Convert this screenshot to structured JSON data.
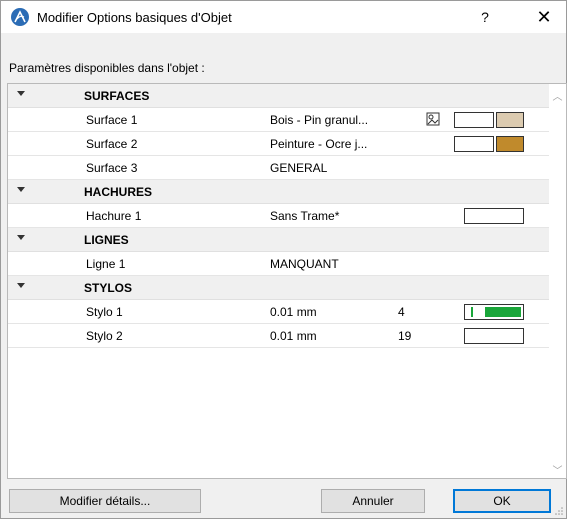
{
  "window": {
    "title": "Modifier Options basiques d'Objet",
    "help_label": "?",
    "close_label": "✕"
  },
  "panel": {
    "label": "Paramètres disponibles dans l'objet :"
  },
  "groups": [
    {
      "name": "SURFACES",
      "rows": [
        {
          "name": "Surface 1",
          "value": "Bois - Pin granul...",
          "swatch_color": "#dccbb0",
          "has_picker_icon": true
        },
        {
          "name": "Surface 2",
          "value": "Peinture - Ocre j...",
          "swatch_color": "#c08a2c"
        },
        {
          "name": "Surface 3",
          "value": "GENERAL"
        }
      ]
    },
    {
      "name": "HACHURES",
      "rows": [
        {
          "name": "Hachure 1",
          "value": "Sans Trame*"
        }
      ]
    },
    {
      "name": "LIGNES",
      "rows": [
        {
          "name": "Ligne 1",
          "value": "MANQUANT"
        }
      ]
    },
    {
      "name": "STYLOS",
      "rows": [
        {
          "name": "Stylo 1",
          "value": "0.01 mm",
          "number": "4",
          "pen_color": "#1aa63a"
        },
        {
          "name": "Stylo 2",
          "value": "0.01 mm",
          "number": "19"
        }
      ]
    }
  ],
  "buttons": {
    "modify_details": "Modifier détails...",
    "cancel": "Annuler",
    "ok": "OK"
  },
  "colors": {
    "accent": "#0078d7",
    "app_icon": "#2b6cb5"
  }
}
